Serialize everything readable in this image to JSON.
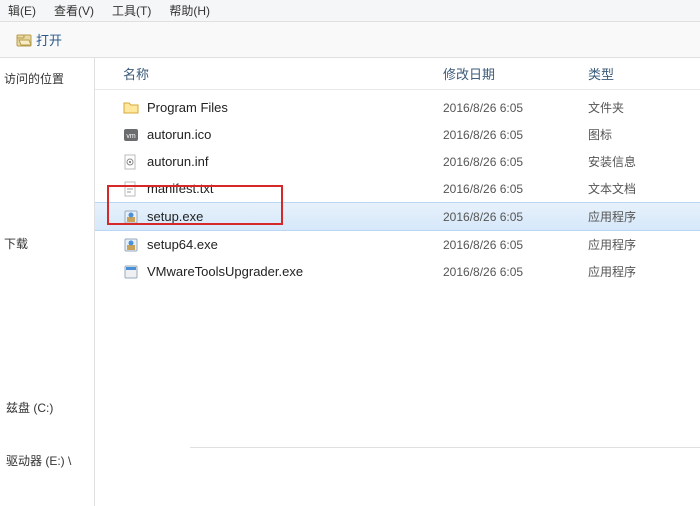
{
  "menu": {
    "edit": "辑(E)",
    "view": "查看(V)",
    "tools": "工具(T)",
    "help": "帮助(H)"
  },
  "toolbar": {
    "open_label": "打开"
  },
  "sidebar": {
    "recent_label": "访问的位置",
    "downloads_label": "下载",
    "disk_c_label": "兹盘 (C:)",
    "drive_e_label": "驱动器 (E:) \\"
  },
  "columns": {
    "name": "名称",
    "date": "修改日期",
    "type": "类型"
  },
  "files": [
    {
      "name": "Program Files",
      "date": "2016/8/26 6:05",
      "type": "文件夹",
      "icon": "folder"
    },
    {
      "name": "autorun.ico",
      "date": "2016/8/26 6:05",
      "type": "图标",
      "icon": "vm"
    },
    {
      "name": "autorun.inf",
      "date": "2016/8/26 6:05",
      "type": "安装信息",
      "icon": "inf"
    },
    {
      "name": "manifest.txt",
      "date": "2016/8/26 6:05",
      "type": "文本文档",
      "icon": "txt"
    },
    {
      "name": "setup.exe",
      "date": "2016/8/26 6:05",
      "type": "应用程序",
      "icon": "installer"
    },
    {
      "name": "setup64.exe",
      "date": "2016/8/26 6:05",
      "type": "应用程序",
      "icon": "installer"
    },
    {
      "name": "VMwareToolsUpgrader.exe",
      "date": "2016/8/26 6:05",
      "type": "应用程序",
      "icon": "exe"
    }
  ],
  "selected_index": 4,
  "highlight_index": 4
}
